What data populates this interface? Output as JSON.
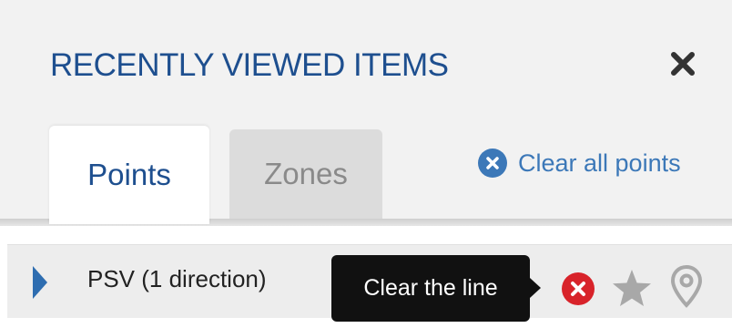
{
  "panel": {
    "title": "RECENTLY VIEWED ITEMS"
  },
  "tabs": [
    {
      "label": "Points",
      "active": true
    },
    {
      "label": "Zones",
      "active": false
    }
  ],
  "actions": {
    "clear_all_label": "Clear all points"
  },
  "list": {
    "items": [
      {
        "label": "PSV (1 direction)",
        "tooltip": "Clear the line"
      }
    ]
  },
  "icons": {
    "close": "close-icon",
    "clear_all": "clear-circle-icon",
    "expand": "caret-right-icon",
    "clear_line": "clear-circle-red-icon",
    "favorite": "star-icon",
    "location": "map-pin-icon"
  },
  "colors": {
    "title": "#1e4f8f",
    "link": "#3c78b8",
    "clear_line": "#d8232a",
    "icon_gray": "#a8a8a8",
    "tooltip_bg": "#111111"
  }
}
